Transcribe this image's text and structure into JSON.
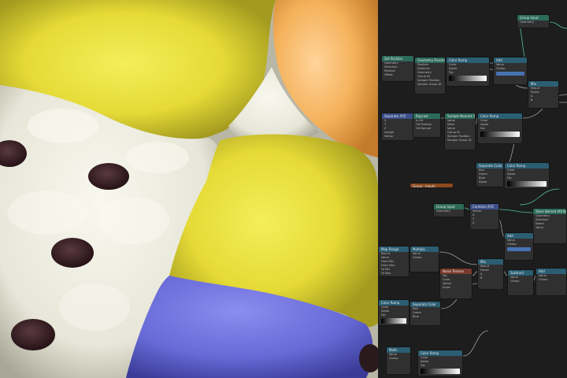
{
  "editor": {
    "node_labels": [
      {
        "id": "group-input-top",
        "header": "Group Input",
        "rows": [
          "Geometry"
        ],
        "color": "#2c6b59"
      },
      {
        "id": "set-position",
        "header": "Set Position",
        "rows": [
          "Geometry",
          "Selection",
          "Position",
          "Offset"
        ],
        "color": "#2c6b59"
      },
      {
        "id": "geometry-proximity",
        "header": "Geometry Proximity",
        "rows": [
          "Position",
          "Distance",
          "Geometry",
          "Group ID",
          "Sample Position",
          "Sample Group ID"
        ],
        "color": "#2c6b59"
      },
      {
        "id": "color-ramp-a",
        "header": "Color Ramp",
        "rows": [
          "Color",
          "Alpha",
          "Fac"
        ],
        "color": "#2b5e73"
      },
      {
        "id": "math-a",
        "header": "Add",
        "rows": [
          "Value",
          "Clamp"
        ],
        "color": "#2b5e73"
      },
      {
        "id": "mix-a",
        "header": "Mix",
        "rows": [
          "Result",
          "Factor",
          "A",
          "B"
        ],
        "color": "#2b5e73"
      },
      {
        "id": "separate-xyz",
        "header": "Separate XYZ",
        "rows": [
          "X",
          "Y",
          "Z",
          "Length",
          "Vector"
        ],
        "color": "#3b4f8a"
      },
      {
        "id": "raycast",
        "header": "Raycast",
        "rows": [
          "Is Hit",
          "Hit Position",
          "Hit Normal"
        ],
        "color": "#2c6b59"
      },
      {
        "id": "sample-nearest",
        "header": "Sample Nearest Surface",
        "rows": [
          "Value",
          "Mesh",
          "Value",
          "Group ID",
          "Sample Position",
          "Sample Group ID"
        ],
        "color": "#2c6b59"
      },
      {
        "id": "color-ramp-b",
        "header": "Color Ramp",
        "rows": [
          "Color",
          "Alpha",
          "Fac"
        ],
        "color": "#2b5e73"
      },
      {
        "id": "separate-color",
        "header": "Separate Color",
        "rows": [
          "Red",
          "Green",
          "Blue",
          "Alpha"
        ],
        "color": "#2b5e73"
      },
      {
        "id": "color-ramp-c",
        "header": "Color Ramp",
        "rows": [
          "Color",
          "Alpha",
          "Fac"
        ],
        "color": "#2b5e73"
      },
      {
        "id": "frame-label",
        "header": "Group - Inputs",
        "rows": [],
        "color": "#8a4a1e"
      },
      {
        "id": "group-input-mid",
        "header": "Group Input",
        "rows": [
          "Geometry"
        ],
        "color": "#2c6b59"
      },
      {
        "id": "combine-xyz",
        "header": "Combine XYZ",
        "rows": [
          "Vector",
          "X",
          "Y",
          "Z"
        ],
        "color": "#3b4f8a"
      },
      {
        "id": "store-attr",
        "header": "Store Named Attribute",
        "rows": [
          "Geometry",
          "Selection",
          "Name",
          "Value"
        ],
        "color": "#2c6b59"
      },
      {
        "id": "math-b",
        "header": "Add",
        "rows": [
          "Value",
          "Clamp"
        ],
        "color": "#2b5e73"
      },
      {
        "id": "math-c",
        "header": "Multiply",
        "rows": [
          "Value",
          "Clamp"
        ],
        "color": "#2b5e73"
      },
      {
        "id": "map-range",
        "header": "Map Range",
        "rows": [
          "Result",
          "Value",
          "From Min",
          "From Max",
          "To Min",
          "To Max"
        ],
        "color": "#2b5e73"
      },
      {
        "id": "mix-b",
        "header": "Mix",
        "rows": [
          "Result",
          "Factor",
          "A",
          "B"
        ],
        "color": "#2b5e73"
      },
      {
        "id": "noise-tex",
        "header": "Noise Texture",
        "rows": [
          "Fac",
          "Color",
          "Vector",
          "Scale"
        ],
        "color": "#7a3a2d"
      },
      {
        "id": "math-d",
        "header": "Add",
        "rows": [
          "Value",
          "Clamp"
        ],
        "color": "#2b5e73"
      },
      {
        "id": "subtract",
        "header": "Subtract",
        "rows": [
          "Value",
          "Clamp"
        ],
        "color": "#2b5e73"
      },
      {
        "id": "color-ramp-d",
        "header": "Color Ramp",
        "rows": [
          "Color",
          "Alpha",
          "Fac"
        ],
        "color": "#2b5e73"
      },
      {
        "id": "separate-color-b",
        "header": "Separate Color",
        "rows": [
          "Red",
          "Green",
          "Blue"
        ],
        "color": "#2b5e73"
      },
      {
        "id": "color-ramp-e",
        "header": "Color Ramp",
        "rows": [
          "Color",
          "Alpha",
          "Fac"
        ],
        "color": "#2b5e73"
      },
      {
        "id": "math-e",
        "header": "Math",
        "rows": [
          "Value",
          "Clamp"
        ],
        "color": "#2b5e73"
      }
    ]
  },
  "colors": {
    "yellow": "#e6dc3a",
    "orange": "#f2a94a",
    "cream": "#e7e6da",
    "blue": "#6d6fd8",
    "brown": "#3a2229",
    "editor_bg": "#1d1d1d"
  }
}
